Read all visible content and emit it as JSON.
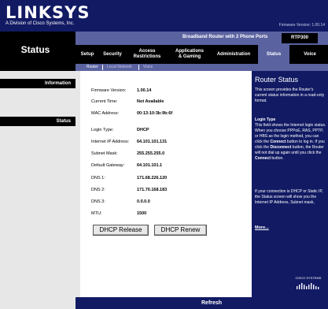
{
  "header": {
    "brand": "LINKSYS",
    "brand_sub": "A Division of Cisco Systems, Inc.",
    "firmware_version": "Firmware Version: 1.00.14"
  },
  "page_title": "Status",
  "product": {
    "name": "Broadband Router with 2 Phone Ports",
    "model": "RTP300"
  },
  "nav": {
    "tabs": [
      {
        "label": "Setup"
      },
      {
        "label": "Security"
      },
      {
        "label": "Access",
        "label2": "Restrictions"
      },
      {
        "label": "Applications",
        "label2": "& Gaming"
      },
      {
        "label": "Administration"
      },
      {
        "label": "Status"
      },
      {
        "label": "Voice"
      }
    ],
    "subtabs": [
      "Router",
      "Local Network",
      "Voice"
    ]
  },
  "sections": {
    "information": "Information",
    "status": "Status"
  },
  "info": {
    "firmware_label": "Firmware Version:",
    "firmware_value": "1.00.14",
    "time_label": "Current Time:",
    "time_value": "Not Available",
    "mac_label": "MAC Address:",
    "mac_value": "00:13:10:3b:9b:6f"
  },
  "status": {
    "login_type_label": "Login Type:",
    "login_type_value": "DHCP",
    "ip_label": "Internet IP Address:",
    "ip_value": "64.101.101.131",
    "subnet_label": "Subnet Mask:",
    "subnet_value": "255.255.255.0",
    "gateway_label": "Default Gateway:",
    "gateway_value": "64.101.101.1",
    "dns1_label": "DNS 1:",
    "dns1_value": "171.68.226.120",
    "dns2_label": "DNS 2:",
    "dns2_value": "171.70.168.183",
    "dns3_label": "DNS 3:",
    "dns3_value": "0.0.0.0",
    "mtu_label": "MTU:",
    "mtu_value": "1500"
  },
  "buttons": {
    "dhcp_release": "DHCP Release",
    "dhcp_renew": "DHCP Renew",
    "refresh": "Refresh"
  },
  "help": {
    "title": "Router Status",
    "intro": "This screen provides the Router's current status information in a read-only format.",
    "login_type_heading": "Login Type",
    "login_type_p1": "This field shows the Internet login status. When you choose PPPoE, RAS, PPTP, or HBS as the login method, you can click the",
    "connect_word": "Connect",
    "login_type_p2": "button to log in. If you click the",
    "disconnect_word": "Disconnect",
    "login_type_p3": "button, the Router will not dial up again until you click the",
    "login_type_p4": "button.",
    "dhcp_para": "If your connection is DHCP or Static IP, the Status screen will show you the Internet IP Address, Subnet mask,",
    "more": "More..."
  },
  "footer": {
    "cisco_name": "CISCO SYSTEMS"
  }
}
